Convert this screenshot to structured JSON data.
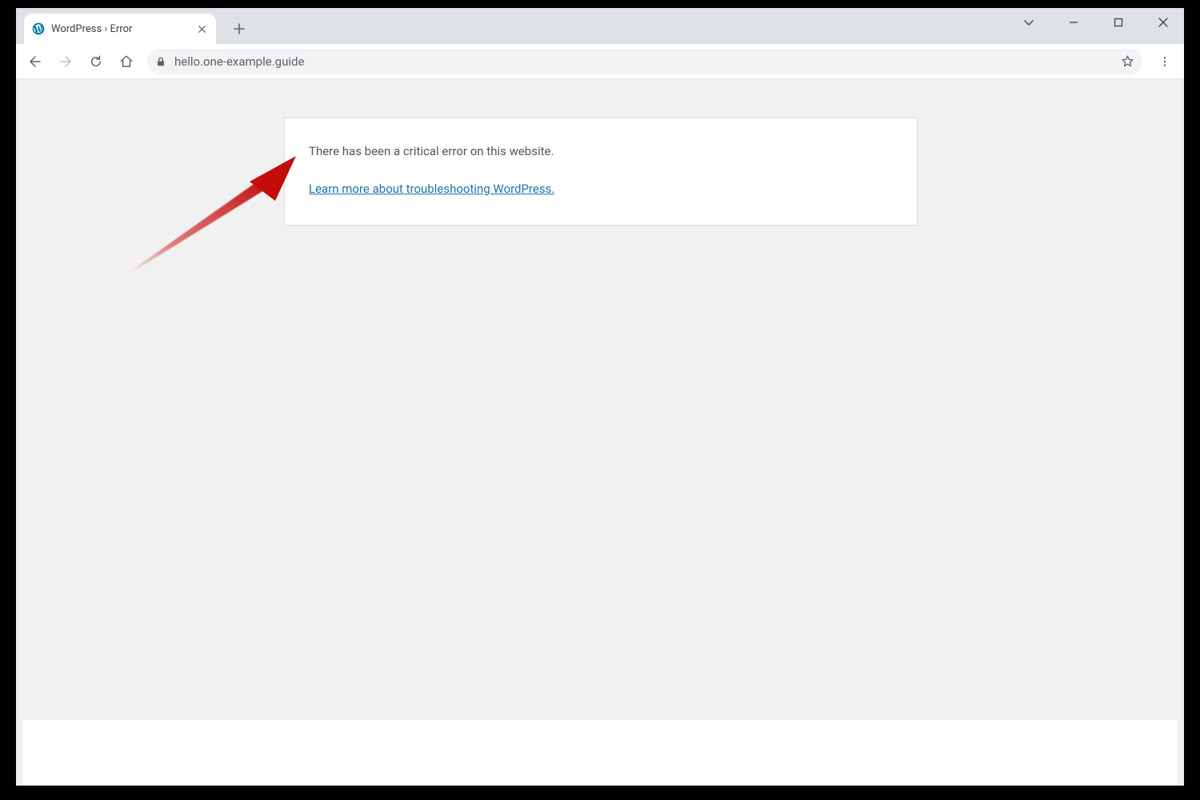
{
  "browser": {
    "tab_title": "WordPress › Error",
    "url": "hello.one-example.guide"
  },
  "page": {
    "error_message": "There has been a critical error on this website.",
    "link_text": "Learn more about troubleshooting WordPress."
  }
}
